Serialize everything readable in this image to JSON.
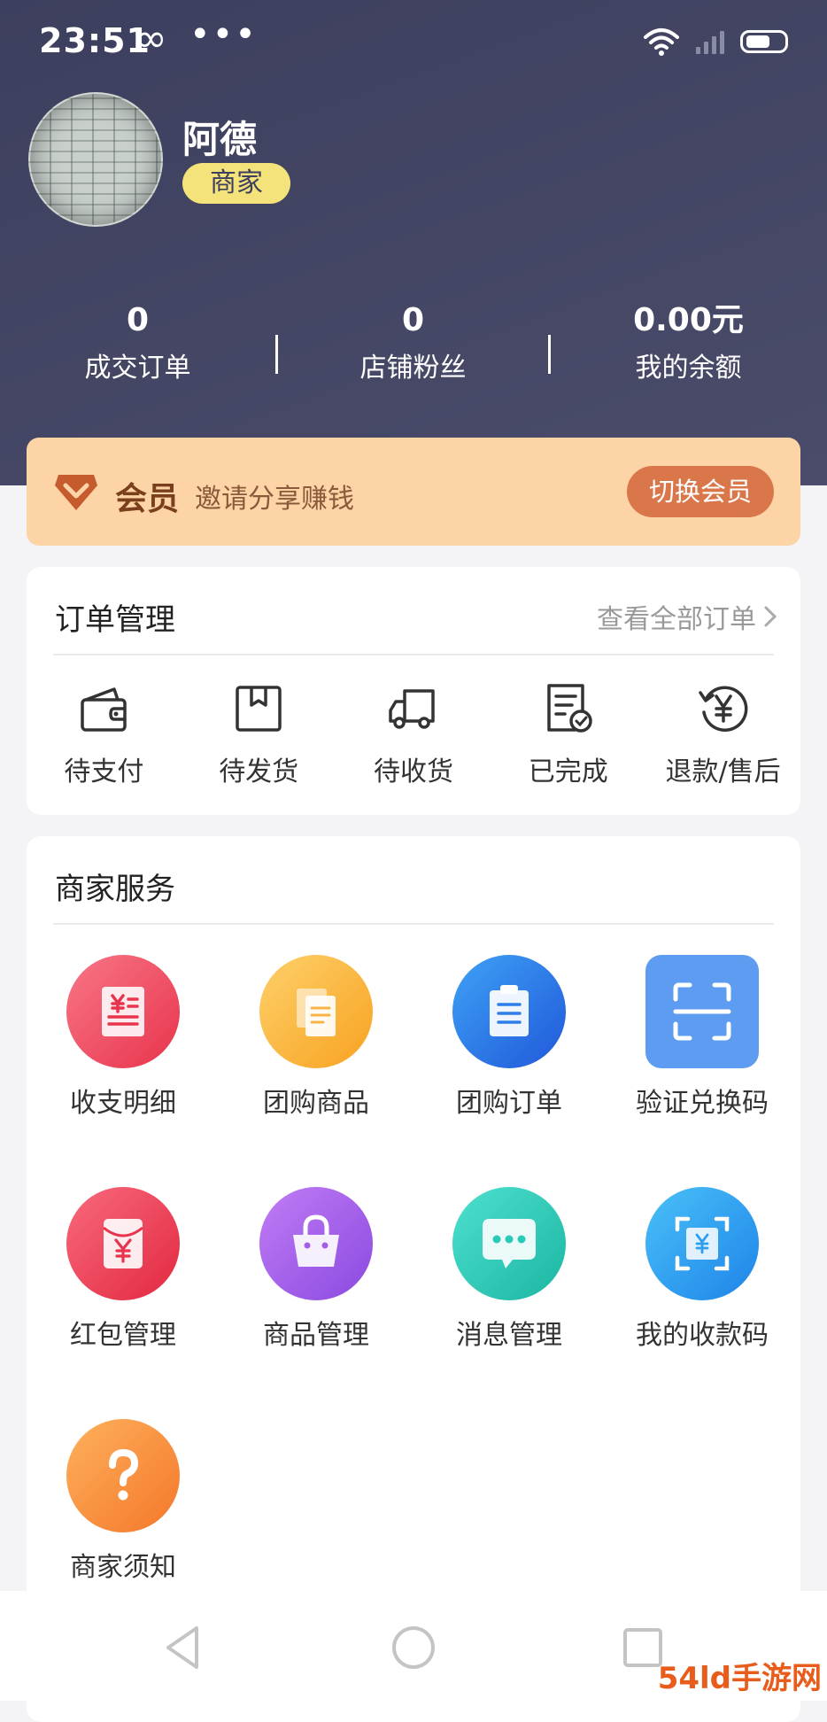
{
  "status_bar": {
    "time": "23:51",
    "infinity_icon": "infinity-icon",
    "more_icon": "more-dots-icon",
    "wifi_icon": "wifi-icon",
    "signal_icon": "signal-icon",
    "battery_icon": "battery-icon",
    "infinity_glyph": "∞",
    "dots_glyph": "•••"
  },
  "profile": {
    "name": "阿德",
    "role": "商家",
    "avatar_icon": "avatar-photo"
  },
  "stats": [
    {
      "value": "0",
      "label": "成交订单"
    },
    {
      "value": "0",
      "label": "店铺粉丝"
    },
    {
      "value": "0.00元",
      "label": "我的余额"
    }
  ],
  "member": {
    "title": "会员",
    "desc": "邀请分享赚钱",
    "button": "切换会员",
    "icon": "diamond-icon"
  },
  "orders": {
    "title": "订单管理",
    "view_all": "查看全部订单",
    "items": [
      {
        "label": "待支付",
        "icon": "wallet-icon"
      },
      {
        "label": "待发货",
        "icon": "package-icon"
      },
      {
        "label": "待收货",
        "icon": "truck-icon"
      },
      {
        "label": "已完成",
        "icon": "completed-doc-icon"
      },
      {
        "label": "退款/售后",
        "icon": "refund-icon"
      }
    ]
  },
  "services": {
    "title": "商家服务",
    "items": [
      {
        "label": "收支明细",
        "icon": "receipt-icon",
        "color": "#ee4a5e"
      },
      {
        "label": "团购商品",
        "icon": "documents-icon",
        "color": "#fbb53a"
      },
      {
        "label": "团购订单",
        "icon": "clipboard-icon",
        "color": "#2f7ee8"
      },
      {
        "label": "验证兑换码",
        "icon": "scan-icon",
        "color": "#5d9cf0"
      },
      {
        "label": "红包管理",
        "icon": "red-envelope-icon",
        "color": "#ee4057"
      },
      {
        "label": "商品管理",
        "icon": "shopping-bag-icon",
        "color": "#a35ee8"
      },
      {
        "label": "消息管理",
        "icon": "message-icon",
        "color": "#29cbb8"
      },
      {
        "label": "我的收款码",
        "icon": "payment-qr-icon",
        "color": "#2e9ff0"
      },
      {
        "label": "商家须知",
        "icon": "question-icon",
        "color": "#fb8f3a"
      }
    ]
  },
  "nav": {
    "back_icon": "back-triangle-icon",
    "home_icon": "home-circle-icon",
    "recent_icon": "recent-square-icon"
  },
  "watermark": "54ld手游网"
}
